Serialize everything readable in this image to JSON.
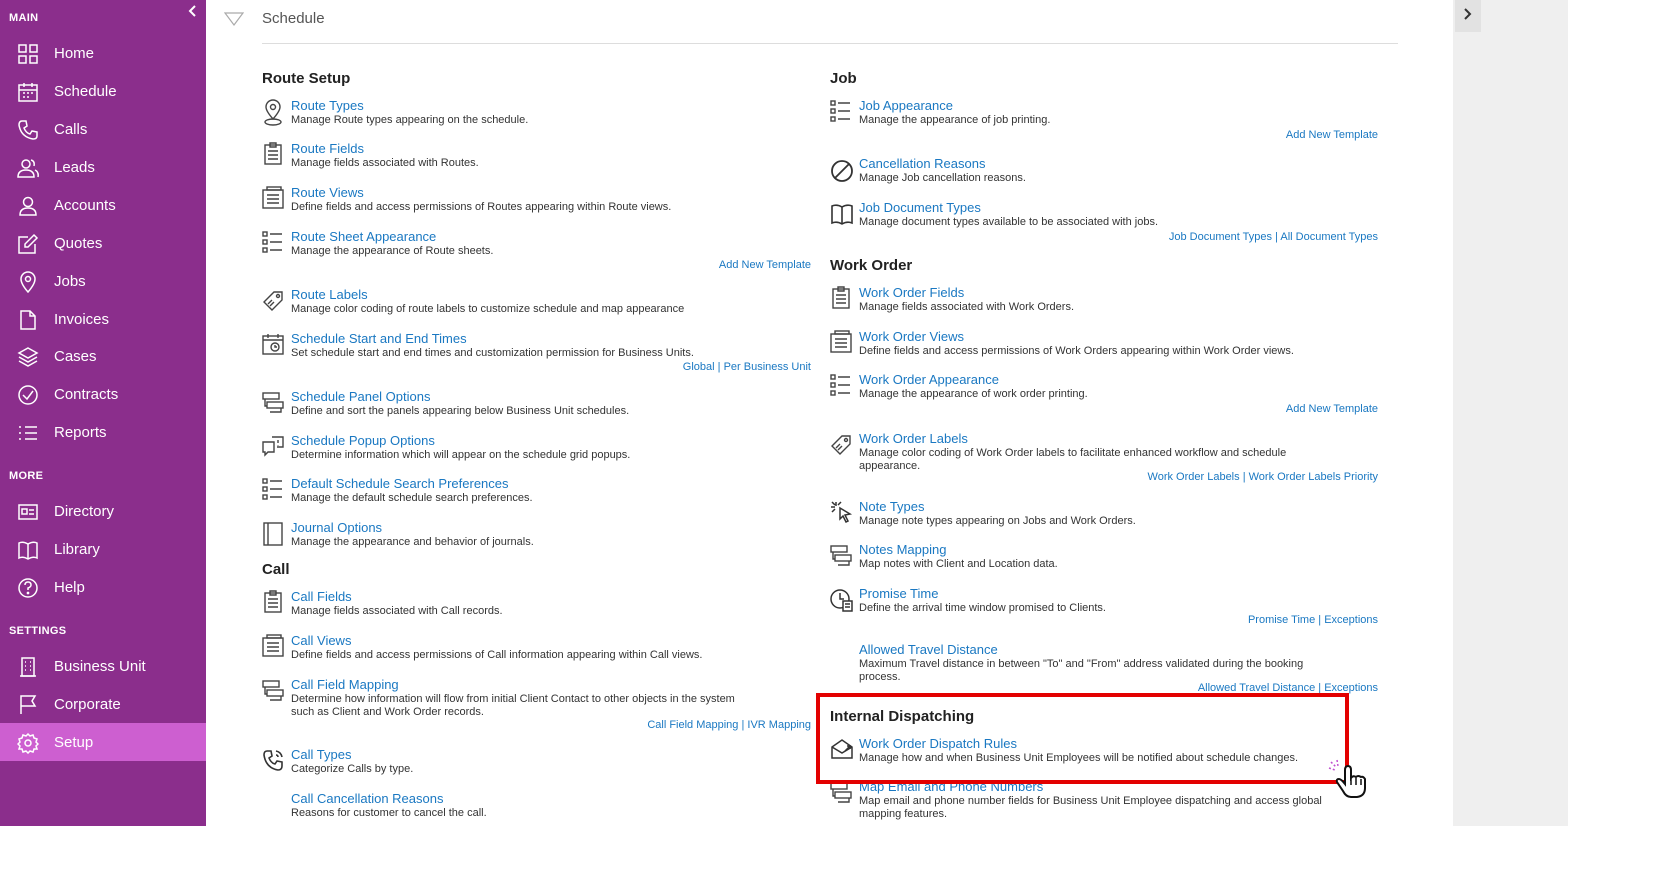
{
  "sidebar": {
    "sections": {
      "main": "MAIN",
      "more": "MORE",
      "settings": "SETTINGS"
    },
    "items": [
      {
        "label": "Home",
        "icon": "grid-icon"
      },
      {
        "label": "Schedule",
        "icon": "calendar-icon"
      },
      {
        "label": "Calls",
        "icon": "phone-icon"
      },
      {
        "label": "Leads",
        "icon": "users-icon"
      },
      {
        "label": "Accounts",
        "icon": "user-icon"
      },
      {
        "label": "Quotes",
        "icon": "edit-icon"
      },
      {
        "label": "Jobs",
        "icon": "pin-icon"
      },
      {
        "label": "Invoices",
        "icon": "file-icon"
      },
      {
        "label": "Cases",
        "icon": "layers-icon"
      },
      {
        "label": "Contracts",
        "icon": "check-circle-icon"
      },
      {
        "label": "Reports",
        "icon": "list-icon"
      },
      {
        "label": "Directory",
        "icon": "id-card-icon"
      },
      {
        "label": "Library",
        "icon": "book-icon"
      },
      {
        "label": "Help",
        "icon": "question-icon"
      },
      {
        "label": "Business Unit",
        "icon": "building-icon"
      },
      {
        "label": "Corporate",
        "icon": "flag-icon"
      },
      {
        "label": "Setup",
        "icon": "gear-icon"
      }
    ],
    "active": "Setup",
    "colors": {
      "bg": "#8b2e8c",
      "active": "#cd5fd0"
    }
  },
  "header": {
    "title": "Schedule"
  },
  "left": {
    "route_setup": "Route Setup",
    "route_types": {
      "title": "Route Types",
      "desc": "Manage Route types appearing on the schedule."
    },
    "route_fields": {
      "title": "Route Fields",
      "desc": "Manage fields associated with Routes."
    },
    "route_views": {
      "title": "Route Views",
      "desc": "Define fields and access permissions of Routes appearing within Route views."
    },
    "route_sheet": {
      "title": "Route Sheet Appearance",
      "desc": "Manage the appearance of Route sheets.",
      "link": "Add New Template"
    },
    "route_labels": {
      "title": "Route Labels",
      "desc": "Manage color coding of route labels to customize schedule and map appearance"
    },
    "schedule_times": {
      "title": "Schedule Start and End Times",
      "desc": "Set schedule start and end times and customization permission for Business Units.",
      "link1": "Global",
      "link2": "Per Business Unit"
    },
    "panel_options": {
      "title": "Schedule Panel Options",
      "desc": "Define and sort the panels appearing below Business Unit schedules."
    },
    "popup_options": {
      "title": "Schedule Popup Options",
      "desc": "Determine information which will appear on the schedule grid popups."
    },
    "search_prefs": {
      "title": "Default Schedule Search Preferences",
      "desc": "Manage the default schedule search preferences."
    },
    "journal": {
      "title": "Journal Options",
      "desc": "Manage the appearance and behavior of journals."
    },
    "call": "Call",
    "call_fields": {
      "title": "Call Fields",
      "desc": "Manage fields associated with Call records."
    },
    "call_views": {
      "title": "Call Views",
      "desc": "Define fields and access permissions of Call information appearing within Call views."
    },
    "call_mapping": {
      "title": "Call Field Mapping",
      "desc1": "Determine how information will flow from initial Client Contact to other objects in the system",
      "desc2": "such as Client and Work Order records.",
      "link1": "Call Field Mapping",
      "link2": "IVR Mapping"
    },
    "call_types": {
      "title": "Call Types",
      "desc": "Categorize Calls by type."
    },
    "call_cancel": {
      "title": "Call Cancellation Reasons",
      "desc": "Reasons for customer to cancel the call."
    }
  },
  "right": {
    "job": "Job",
    "job_appearance": {
      "title": "Job Appearance",
      "desc": "Manage the appearance of job printing.",
      "link": "Add New Template"
    },
    "cancel_reasons": {
      "title": "Cancellation Reasons",
      "desc": "Manage Job cancellation reasons."
    },
    "doc_types": {
      "title": "Job Document Types",
      "desc": "Manage document types available to be associated with jobs.",
      "link1": "Job Document Types",
      "link2": "All Document Types"
    },
    "work_order": "Work Order",
    "wo_fields": {
      "title": "Work Order Fields",
      "desc": "Manage fields associated with Work Orders."
    },
    "wo_views": {
      "title": "Work Order Views",
      "desc": "Define fields and access permissions of Work Orders appearing within Work Order views."
    },
    "wo_appearance": {
      "title": "Work Order Appearance",
      "desc": "Manage the appearance of work order printing.",
      "link": "Add New Template"
    },
    "wo_labels": {
      "title": "Work Order Labels",
      "desc1": "Manage color coding of Work Order labels to facilitate enhanced workflow and schedule",
      "desc2": "appearance.",
      "link1": "Work Order Labels",
      "link2": "Work Order Labels Priority"
    },
    "note_types": {
      "title": "Note Types",
      "desc": "Manage note types appearing on Jobs and Work Orders."
    },
    "notes_mapping": {
      "title": "Notes Mapping",
      "desc": "Map notes with Client and Location data."
    },
    "promise_time": {
      "title": "Promise Time",
      "desc": "Define the arrival time window promised to Clients.",
      "link1": "Promise Time",
      "link2": "Exceptions"
    },
    "travel_distance": {
      "title": "Allowed Travel Distance",
      "desc1": "Maximum Travel distance in between \"To\" and \"From\" address validated during the booking",
      "desc2": "process.",
      "link1": "Allowed Travel Distance",
      "link2": "Exceptions"
    },
    "internal_dispatching": "Internal Dispatching",
    "dispatch_rules": {
      "title": "Work Order Dispatch Rules",
      "desc": "Manage how and when Business Unit Employees will be notified about schedule changes."
    },
    "map_email": {
      "title": "Map Email and Phone Numbers",
      "desc1": "Map email and phone number fields for Business Unit Employee dispatching and access global",
      "desc2": "mapping features."
    }
  },
  "separator": "|",
  "colors": {
    "link": "#1a78c2",
    "highlight": "#e30000"
  }
}
